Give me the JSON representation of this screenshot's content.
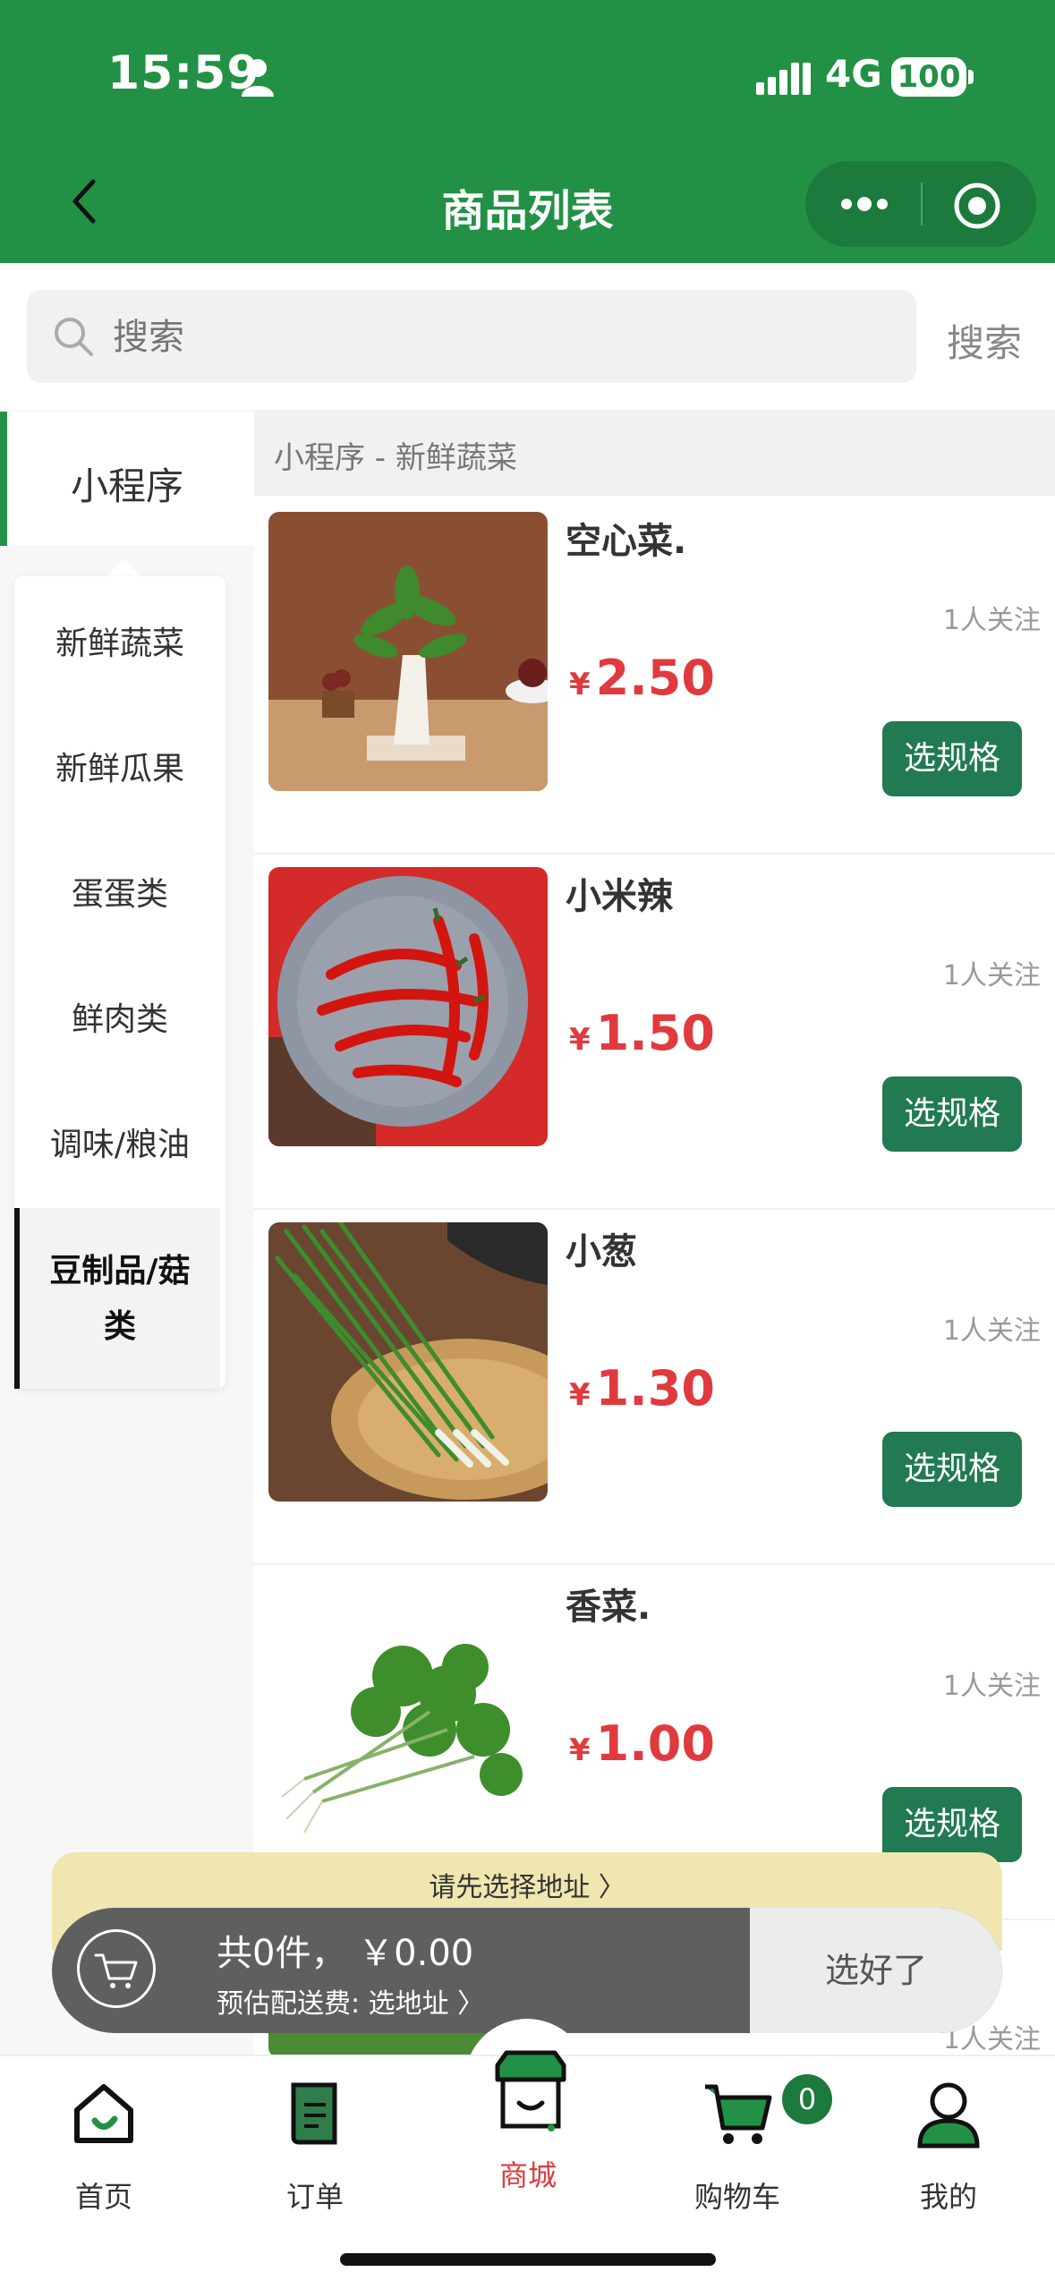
{
  "status_bar": {
    "time": "15:59",
    "network": "4G",
    "battery": "100"
  },
  "header": {
    "title": "商品列表"
  },
  "search": {
    "placeholder": "搜索",
    "button": "搜索"
  },
  "sidebar": {
    "top_tab": "小程序",
    "categories": [
      {
        "label": "新鲜蔬菜"
      },
      {
        "label": "新鲜瓜果"
      },
      {
        "label": "蛋蛋类"
      },
      {
        "label": "鲜肉类"
      },
      {
        "label": "调味/粮油"
      },
      {
        "label": "豆制品/菇类"
      }
    ],
    "active_index": 5
  },
  "list": {
    "category_title": "小程序 - 新鲜蔬菜",
    "products": [
      {
        "name": "空心菜.",
        "followers": "1人关注",
        "currency": "¥",
        "price": "2.50",
        "button": "选规格"
      },
      {
        "name": "小米辣",
        "followers": "1人关注",
        "currency": "¥",
        "price": "1.50",
        "button": "选规格"
      },
      {
        "name": "小葱",
        "followers": "1人关注",
        "currency": "¥",
        "price": "1.30",
        "button": "选规格"
      },
      {
        "name": "香菜.",
        "followers": "1人关注",
        "currency": "¥",
        "price": "1.00",
        "button": "选规格"
      }
    ],
    "partial_followers": "1人关注"
  },
  "cart_bar": {
    "address_tip": "请先选择地址 〉",
    "total": "共0件， ￥0.00",
    "delivery_fee": "预估配送费: 选地址 〉",
    "confirm": "选好了"
  },
  "tabbar": {
    "items": [
      {
        "label": "首页",
        "icon": "home-icon"
      },
      {
        "label": "订单",
        "icon": "order-icon"
      },
      {
        "label": "商城",
        "icon": "store-icon"
      },
      {
        "label": "购物车",
        "icon": "cart-icon"
      },
      {
        "label": "我的",
        "icon": "user-icon"
      }
    ],
    "active_index": 2,
    "cart_badge": "0"
  },
  "colors": {
    "brand": "#229146",
    "price": "#e03a3e",
    "button": "#217a52",
    "tab_active": "#e03a3e"
  }
}
